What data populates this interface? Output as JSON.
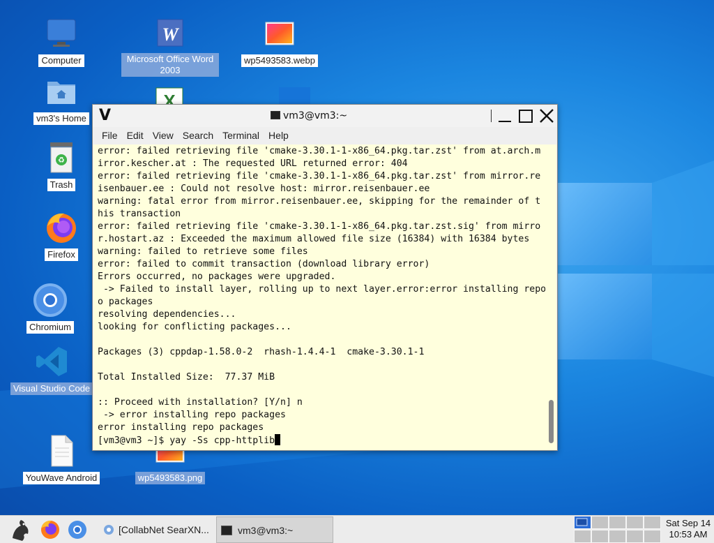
{
  "desktop": {
    "icons": [
      {
        "name": "computer",
        "label": "Computer"
      },
      {
        "name": "msword",
        "label": "Microsoft Office Word 2003"
      },
      {
        "name": "webp-file",
        "label": "wp5493583.webp"
      },
      {
        "name": "home",
        "label": "vm3's Home"
      },
      {
        "name": "trash",
        "label": "Trash"
      },
      {
        "name": "firefox",
        "label": "Firefox"
      },
      {
        "name": "chromium",
        "label": "Chromium"
      },
      {
        "name": "vscode",
        "label": "Visual Studio Code"
      },
      {
        "name": "youwave",
        "label": "YouWave Android"
      },
      {
        "name": "png-file",
        "label": "wp5493583.png"
      }
    ]
  },
  "window": {
    "app_letter": "V",
    "title": "vm3@vm3:~",
    "menu": [
      "File",
      "Edit",
      "View",
      "Search",
      "Terminal",
      "Help"
    ],
    "lines": [
      "error: failed retrieving file 'cmake-3.30.1-1-x86_64.pkg.tar.zst' from at.arch.m",
      "irror.kescher.at : The requested URL returned error: 404",
      "error: failed retrieving file 'cmake-3.30.1-1-x86_64.pkg.tar.zst' from mirror.re",
      "isenbauer.ee : Could not resolve host: mirror.reisenbauer.ee",
      "warning: fatal error from mirror.reisenbauer.ee, skipping for the remainder of t",
      "his transaction",
      "error: failed retrieving file 'cmake-3.30.1-1-x86_64.pkg.tar.zst.sig' from mirro",
      "r.hostart.az : Exceeded the maximum allowed file size (16384) with 16384 bytes",
      "warning: failed to retrieve some files",
      "error: failed to commit transaction (download library error)",
      "Errors occurred, no packages were upgraded.",
      " -> Failed to install layer, rolling up to next layer.error:error installing repo",
      "o packages",
      "resolving dependencies...",
      "looking for conflicting packages...",
      "",
      "Packages (3) cppdap-1.58.0-2  rhash-1.4.4-1  cmake-3.30.1-1",
      "",
      "Total Installed Size:  77.37 MiB",
      "",
      ":: Proceed with installation? [Y/n] n",
      " -> error installing repo packages",
      "error installing repo packages"
    ],
    "prompt": "[vm3@vm3 ~]$ yay -Ss cpp-httplib"
  },
  "taskbar": {
    "tasks": [
      {
        "label": "[CollabNet SearXN..."
      },
      {
        "label": "vm3@vm3:~"
      }
    ],
    "clock_day": "Sat Sep 14",
    "clock_time": "10:53 AM"
  }
}
